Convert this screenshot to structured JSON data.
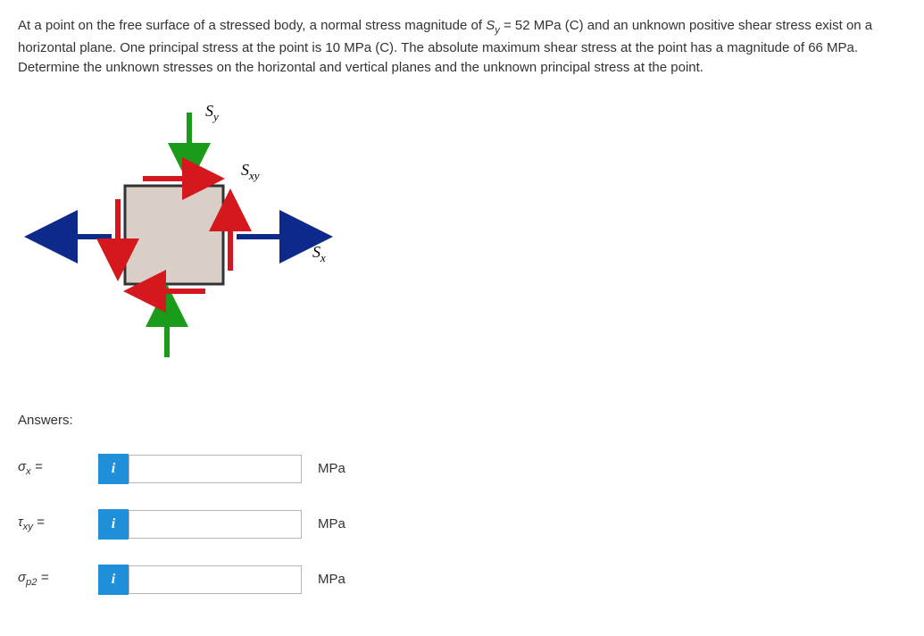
{
  "problem": {
    "line1_pre": "At a point on the free surface of a stressed body, a normal stress magnitude of ",
    "sy_var": "S",
    "sy_sub": "y",
    "sy_val": " = 52 MPa (C) and an unknown positive shear stress",
    "line2": "exist on a horizontal plane. One principal stress at the point is 10 MPa (C). The absolute maximum shear stress at the point has a",
    "line3": "magnitude of 66 MPa. Determine the unknown stresses on the horizontal and vertical planes and the unknown principal stress at the",
    "line4": "point."
  },
  "diagram": {
    "sy_label": "S",
    "sy_sub": "y",
    "sxy_label": "S",
    "sxy_sub": "xy",
    "sx_label": "S",
    "sx_sub": "x"
  },
  "answers_header": "Answers:",
  "inputs": {
    "row1": {
      "symbol": "σ",
      "sub": "x",
      "eq": " =",
      "unit": "MPa",
      "value": ""
    },
    "row2": {
      "symbol": "τ",
      "sub": "xy",
      "eq": " =",
      "unit": "MPa",
      "value": ""
    },
    "row3": {
      "symbol": "σ",
      "sub": "p2",
      "eq": " =",
      "unit": "MPa",
      "value": ""
    }
  },
  "info_icon": "i"
}
